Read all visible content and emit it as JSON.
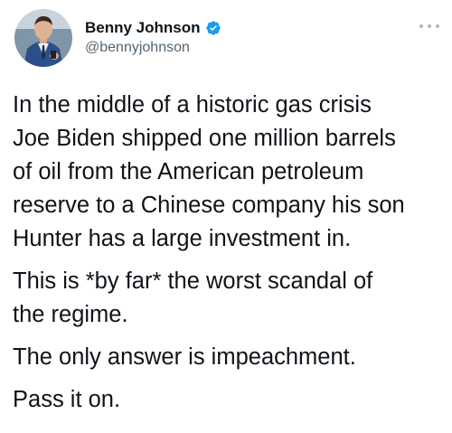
{
  "author": {
    "display_name": "Benny Johnson",
    "handle": "@bennyjohnson",
    "verified_icon": "verified-badge-icon",
    "avatar_icon": "profile-photo",
    "accent": "#1d9bf0"
  },
  "menu": {
    "icon": "more-horizontal-icon"
  },
  "tweet": {
    "paragraph_1": "In the middle of a historic gas crisis\nJoe Biden shipped one million barrels\nof oil from the American petroleum\nreserve to a Chinese company his son\nHunter has a large investment in.",
    "paragraph_2": "This is *by far* the worst scandal of\nthe regime.",
    "paragraph_3": "The only answer is impeachment.",
    "paragraph_4": "Pass it on."
  }
}
